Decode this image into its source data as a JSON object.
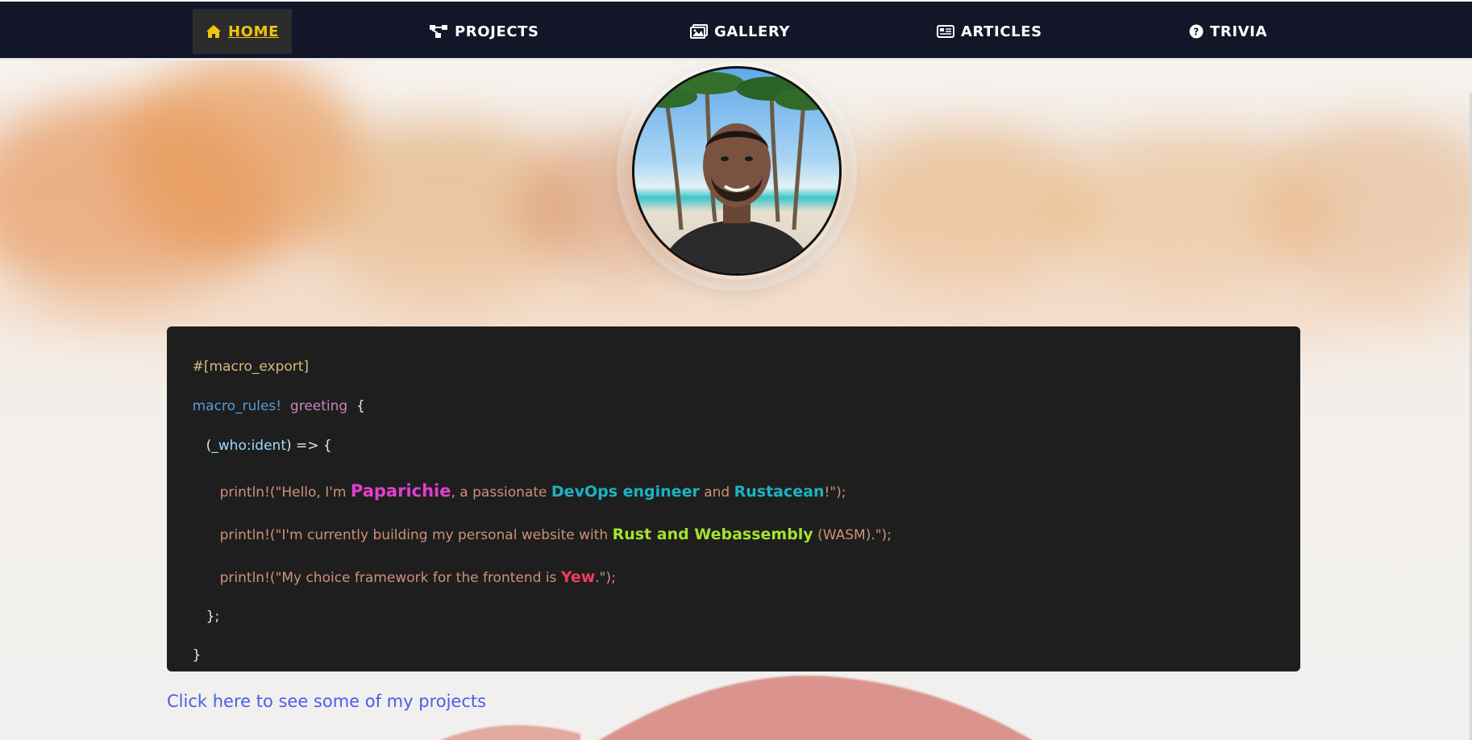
{
  "nav": {
    "items": [
      {
        "label": "HOME",
        "icon": "home-icon",
        "active": true
      },
      {
        "label": "PROJECTS",
        "icon": "sitemap-icon",
        "active": false
      },
      {
        "label": "GALLERY",
        "icon": "images-icon",
        "active": false
      },
      {
        "label": "ARTICLES",
        "icon": "newspaper-icon",
        "active": false
      },
      {
        "label": "TRIVIA",
        "icon": "question-circle-icon",
        "active": false
      }
    ],
    "active_color": "#f1c40f",
    "background_color": "#131628"
  },
  "code": {
    "attr": "#[macro_export]",
    "keyword": "macro_rules!",
    "macro_name": "greeting",
    "open_brace": "{",
    "arm_open": "(",
    "arm_param": "_who:ident",
    "arm_close": ") => {",
    "line1": {
      "prefix": "println!(\"Hello, I'm ",
      "name": "Paparichie",
      "mid": ", a passionate ",
      "role": "DevOps engineer",
      "and": " and ",
      "rustacean": "Rustacean",
      "suffix": "!\");"
    },
    "line2": {
      "prefix": "println!(\"I'm currently building my personal website with ",
      "tech": "Rust and Webassembly",
      "suffix": " (WASM).\");"
    },
    "line3": {
      "prefix": "println!(\"My choice framework for the frontend is ",
      "framework": "Yew",
      "suffix": ".\");"
    },
    "arm_end": "};",
    "close_brace": "}"
  },
  "link": {
    "projects": "Click here to see some of my projects"
  }
}
